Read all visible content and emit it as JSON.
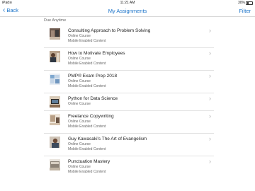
{
  "status_bar": {
    "carrier": "iPad",
    "wifi": "≋",
    "time": "11:21 AM",
    "battery": "30%"
  },
  "nav": {
    "back_label": "Back",
    "title": "My Assignments",
    "filter_label": "Filter"
  },
  "section_header": "Due Anytime",
  "items": [
    {
      "title": "Consulting Approach to Problem Solving",
      "type": "Online Course",
      "meta": "Mobile Enabled Content"
    },
    {
      "title": "How to Motivate Employees",
      "type": "Online Course",
      "meta": "Mobile Enabled Content"
    },
    {
      "title": "PMP® Exam Prep 2018",
      "type": "Online Course",
      "meta": "Mobile Enabled Content"
    },
    {
      "title": "Python for Data Science",
      "type": "Online Course",
      "meta": ""
    },
    {
      "title": "Freelance Copywriting",
      "type": "Online Course",
      "meta": "Mobile Enabled Content"
    },
    {
      "title": "Guy Kawasaki's The Art of Evangelism",
      "type": "Online Course",
      "meta": "Mobile Enabled Content"
    },
    {
      "title": "Punctuation Mastery",
      "type": "Online Course",
      "meta": "Mobile Enabled Content"
    }
  ]
}
